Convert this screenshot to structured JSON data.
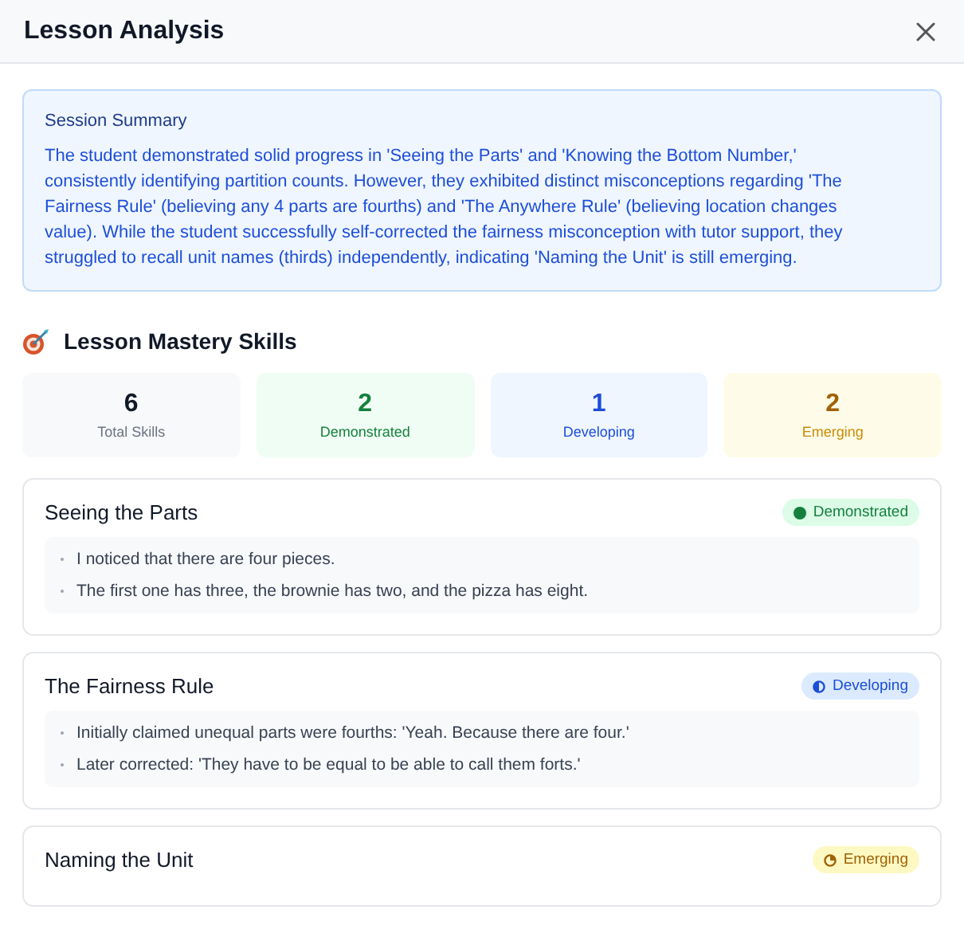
{
  "window": {
    "title": "Lesson Analysis"
  },
  "summary": {
    "title": "Session Summary",
    "text": "The student demonstrated solid progress in 'Seeing the Parts' and 'Knowing the Bottom Number,' consistently identifying partition counts. However, they exhibited distinct misconceptions regarding 'The Fairness Rule' (believing any 4 parts are fourths) and 'The Anywhere Rule' (believing location changes value). While the student successfully self-corrected the fairness misconception with tutor support, they struggled to recall unit names (thirds) independently, indicating 'Naming the Unit' is still emerging."
  },
  "section_title": "Lesson Mastery Skills",
  "stats": [
    {
      "kind": "total",
      "value": "6",
      "label": "Total Skills"
    },
    {
      "kind": "demonstrated",
      "value": "2",
      "label": "Demonstrated"
    },
    {
      "kind": "developing",
      "value": "1",
      "label": "Developing"
    },
    {
      "kind": "emerging",
      "value": "2",
      "label": "Emerging"
    }
  ],
  "skills": [
    {
      "name": "Seeing the Parts",
      "kind": "demonstrated",
      "badge": "Demonstrated",
      "evidence": [
        "I noticed that there are four pieces.",
        "The first one has three, the brownie has two, and the pizza has eight."
      ]
    },
    {
      "name": "The Fairness Rule",
      "kind": "developing",
      "badge": "Developing",
      "evidence": [
        "Initially claimed unequal parts were fourths: 'Yeah. Because there are four.'",
        "Later corrected: 'They have to be equal to be able to call them forts.'"
      ]
    },
    {
      "name": "Naming the Unit",
      "kind": "emerging",
      "badge": "Emerging"
    }
  ]
}
